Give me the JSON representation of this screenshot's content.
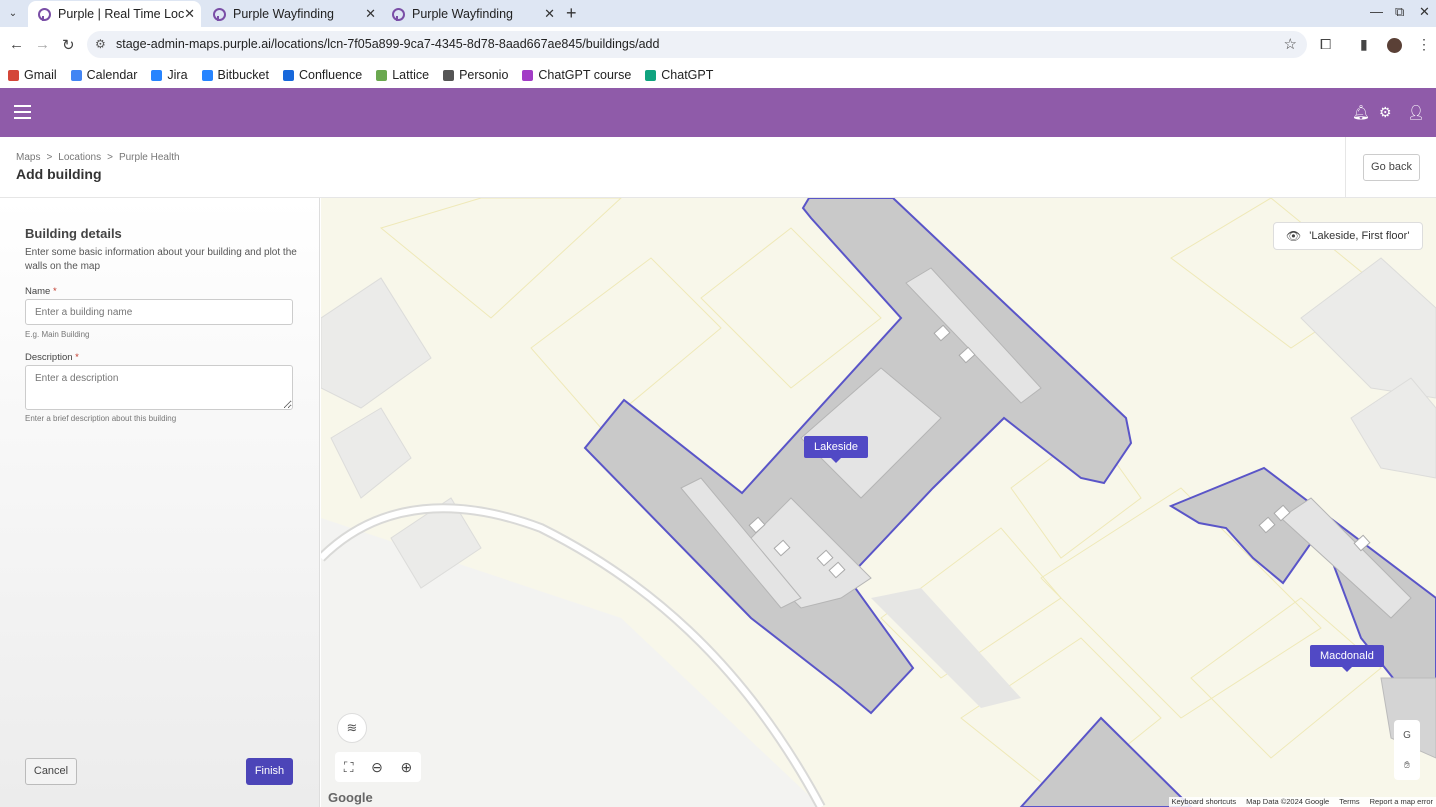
{
  "browser": {
    "tabs": [
      {
        "title": "Purple | Real Time Locati",
        "active": true
      },
      {
        "title": "Purple Wayfinding",
        "active": false
      },
      {
        "title": "Purple Wayfinding",
        "active": false
      }
    ],
    "url": "stage-admin-maps.purple.ai/locations/lcn-7f05a899-9ca7-4345-8d78-8aad667ae845/buildings/add",
    "bookmarks": [
      {
        "label": "Gmail",
        "color": "#d44638"
      },
      {
        "label": "Calendar",
        "color": "#4285f4"
      },
      {
        "label": "Jira",
        "color": "#2684ff"
      },
      {
        "label": "Bitbucket",
        "color": "#2684ff"
      },
      {
        "label": "Confluence",
        "color": "#1868db"
      },
      {
        "label": "Lattice",
        "color": "#6aa84f"
      },
      {
        "label": "Personio",
        "color": "#555555"
      },
      {
        "label": "ChatGPT course",
        "color": "#a23cc6"
      },
      {
        "label": "ChatGPT",
        "color": "#10a37f"
      }
    ]
  },
  "app": {
    "brand_color": "#8f5ba9",
    "icons": [
      "hamburger-menu-icon",
      "bell-icon",
      "gear-icon",
      "user-icon"
    ]
  },
  "header": {
    "breadcrumb": [
      "Maps",
      ">",
      "Locations",
      ">",
      "Purple Health"
    ],
    "title": "Add building",
    "go_back": "Go back"
  },
  "form": {
    "title": "Building details",
    "description": "Enter some basic information about your building and plot the walls on the map",
    "name_label": "Name",
    "name_placeholder": "Enter a building name",
    "name_hint": "E.g. Main Building",
    "description_label": "Description",
    "description_placeholder": "Enter a description",
    "description_hint": "Enter a brief description about this building",
    "required_mark": "*",
    "cancel": "Cancel",
    "finish": "Finish",
    "accent_color": "#4c45b8"
  },
  "map": {
    "floor_chip": "'Lakeside, First floor'",
    "buildings": [
      "Lakeside",
      "Macdonald"
    ],
    "side_control_label": "G",
    "google": "Google",
    "footer": [
      "Keyboard shortcuts",
      "Map Data ©2024 Google",
      "Terms",
      "Report a map error"
    ]
  }
}
